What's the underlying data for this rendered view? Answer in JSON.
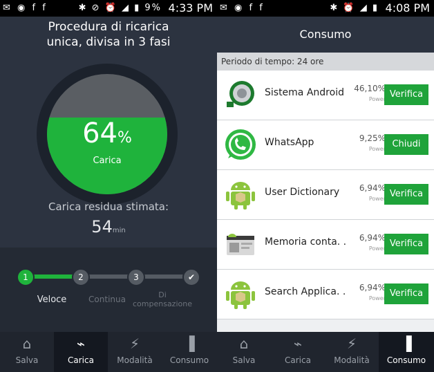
{
  "left": {
    "statusbar": {
      "icons": "✉ ◉ f f",
      "sys_icons": "✱ ⊘ ⏰ ◢ ▮ 9%",
      "time": "4:33 PM"
    },
    "title_line1": "Procedura di ricarica",
    "title_line2": "unica, divisa in 3 fasi",
    "gauge": {
      "percent": 64,
      "percent_text": "64",
      "percent_unit": "%",
      "label": "Carica"
    },
    "residua_label": "Carica residua stimata:",
    "residua_value": "54",
    "residua_unit": "min",
    "steps": [
      {
        "num": "1",
        "label": "Veloce"
      },
      {
        "num": "2",
        "label": "Continua"
      },
      {
        "num": "3",
        "label": "Di compensazione"
      },
      {
        "num": "✔"
      }
    ],
    "step_progress": 0.29,
    "nav": [
      {
        "icon": "⌂",
        "label": "Salva"
      },
      {
        "icon": "⌁",
        "label": "Carica"
      },
      {
        "icon": "⚡",
        "label": "Modalità"
      },
      {
        "icon": "▐",
        "label": "Consumo"
      }
    ]
  },
  "right": {
    "statusbar": {
      "icons": "✉ ◉ f f",
      "sys_icons": "✱ ⏰ ◢ ▮",
      "time": "4:08 PM"
    },
    "header": "Consumo",
    "period": "Periodo di tempo: 24 ore",
    "apps": [
      {
        "name": "Sistema Android",
        "percent": "46,10%",
        "sub": "Power",
        "button": "Verifica"
      },
      {
        "name": "WhatsApp",
        "percent": "9,25%",
        "sub": "Power",
        "button": "Chiudi"
      },
      {
        "name": "User Dictionary",
        "percent": "6,94%",
        "sub": "Power",
        "button": "Verifica"
      },
      {
        "name": "Memoria conta. .",
        "percent": "6,94%",
        "sub": "Power",
        "button": "Verifica"
      },
      {
        "name": "Search Applica. .",
        "percent": "6,94%",
        "sub": "Power",
        "button": "Verifica"
      }
    ],
    "nav": [
      {
        "icon": "⌂",
        "label": "Salva"
      },
      {
        "icon": "⌁",
        "label": "Carica"
      },
      {
        "icon": "⚡",
        "label": "Modalità"
      },
      {
        "icon": "▐",
        "label": "Consumo"
      }
    ]
  },
  "colors": {
    "accent": "#1fb33c",
    "panel": "#2c3340",
    "button": "#1fa33a"
  }
}
